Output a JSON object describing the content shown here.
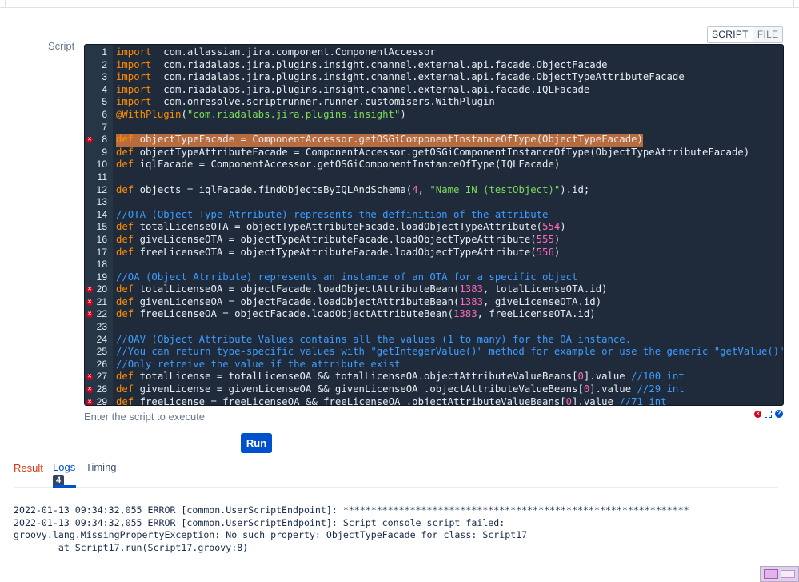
{
  "labels": {
    "script": "Script",
    "enter_hint": "Enter the script to execute",
    "run": "Run"
  },
  "mode_toggle": {
    "script": "SCRIPT",
    "file": "FILE"
  },
  "editor": {
    "error_marker": "✕",
    "lines": [
      {
        "n": "1",
        "err": false,
        "hl": false,
        "segs": [
          [
            "kw",
            "import"
          ],
          [
            "",
            "  com.atlassian.jira.component.ComponentAccessor"
          ]
        ]
      },
      {
        "n": "2",
        "err": false,
        "hl": false,
        "segs": [
          [
            "kw",
            "import"
          ],
          [
            "",
            "  com.riadalabs.jira.plugins.insight.channel.external.api.facade.ObjectFacade"
          ]
        ]
      },
      {
        "n": "3",
        "err": false,
        "hl": false,
        "segs": [
          [
            "kw",
            "import"
          ],
          [
            "",
            "  com.riadalabs.jira.plugins.insight.channel.external.api.facade.ObjectTypeAttributeFacade"
          ]
        ]
      },
      {
        "n": "4",
        "err": false,
        "hl": false,
        "segs": [
          [
            "kw",
            "import"
          ],
          [
            "",
            "  com.riadalabs.jira.plugins.insight.channel.external.api.facade.IQLFacade"
          ]
        ]
      },
      {
        "n": "5",
        "err": false,
        "hl": false,
        "segs": [
          [
            "kw",
            "import"
          ],
          [
            "",
            "  com.onresolve.scriptrunner.runner.customisers.WithPlugin"
          ]
        ]
      },
      {
        "n": "6",
        "err": false,
        "hl": false,
        "segs": [
          [
            "ann",
            "@WithPlugin"
          ],
          [
            "",
            "("
          ],
          [
            "str",
            "\"com.riadalabs.jira.plugins.insight\""
          ],
          [
            "",
            ")"
          ]
        ]
      },
      {
        "n": "7",
        "err": false,
        "hl": false,
        "segs": [
          [
            "",
            ""
          ]
        ]
      },
      {
        "n": "8",
        "err": true,
        "hl": true,
        "segs": [
          [
            "kw",
            "def"
          ],
          [
            "",
            " objectTypeFacade = ComponentAccessor.getOSGiComponentInstanceOfType(ObjectTypeFacade)"
          ]
        ]
      },
      {
        "n": "9",
        "err": false,
        "hl": false,
        "segs": [
          [
            "kw",
            "def"
          ],
          [
            "",
            " objectTypeAttributeFacade = ComponentAccessor.getOSGiComponentInstanceOfType(ObjectTypeAttributeFacade)"
          ]
        ]
      },
      {
        "n": "10",
        "err": false,
        "hl": false,
        "segs": [
          [
            "kw",
            "def"
          ],
          [
            "",
            " iqlFacade = ComponentAccessor.getOSGiComponentInstanceOfType(IQLFacade)"
          ]
        ]
      },
      {
        "n": "11",
        "err": false,
        "hl": false,
        "segs": [
          [
            "",
            ""
          ]
        ]
      },
      {
        "n": "12",
        "err": false,
        "hl": false,
        "segs": [
          [
            "kw",
            "def"
          ],
          [
            "",
            " objects = iqlFacade.findObjectsByIQLAndSchema("
          ],
          [
            "num-lit",
            "4"
          ],
          [
            "",
            ", "
          ],
          [
            "str",
            "\"Name IN (testObject)\""
          ],
          [
            "",
            ").id;"
          ]
        ]
      },
      {
        "n": "13",
        "err": false,
        "hl": false,
        "segs": [
          [
            "",
            ""
          ]
        ]
      },
      {
        "n": "14",
        "err": false,
        "hl": false,
        "segs": [
          [
            "cmt",
            "//OTA (Object Type Atrribute) represents the deffinition of the attribute"
          ]
        ]
      },
      {
        "n": "15",
        "err": false,
        "hl": false,
        "segs": [
          [
            "kw",
            "def"
          ],
          [
            "",
            " totalLicenseOTA = objectTypeAttributeFacade.loadObjectTypeAttribute("
          ],
          [
            "num-lit",
            "554"
          ],
          [
            "",
            ")"
          ]
        ]
      },
      {
        "n": "16",
        "err": false,
        "hl": false,
        "segs": [
          [
            "kw",
            "def"
          ],
          [
            "",
            " giveLicenseOTA = objectTypeAttributeFacade.loadObjectTypeAttribute("
          ],
          [
            "num-lit",
            "555"
          ],
          [
            "",
            ")"
          ]
        ]
      },
      {
        "n": "17",
        "err": false,
        "hl": false,
        "segs": [
          [
            "kw",
            "def"
          ],
          [
            "",
            " freeLicenseOTA = objectTypeAttributeFacade.loadObjectTypeAttribute("
          ],
          [
            "num-lit",
            "556"
          ],
          [
            "",
            ")"
          ]
        ]
      },
      {
        "n": "18",
        "err": false,
        "hl": false,
        "segs": [
          [
            "",
            ""
          ]
        ]
      },
      {
        "n": "19",
        "err": false,
        "hl": false,
        "segs": [
          [
            "cmt",
            "//OA (Object Atrribute) represents an instance of an OTA for a specific object"
          ]
        ]
      },
      {
        "n": "20",
        "err": true,
        "hl": false,
        "segs": [
          [
            "kw",
            "def"
          ],
          [
            "",
            " totalLicenseOA = objectFacade.loadObjectAttributeBean("
          ],
          [
            "num-lit",
            "1383"
          ],
          [
            "",
            ", totalLicenseOTA.id)"
          ]
        ]
      },
      {
        "n": "21",
        "err": true,
        "hl": false,
        "segs": [
          [
            "kw",
            "def"
          ],
          [
            "",
            " givenLicenseOA = objectFacade.loadObjectAttributeBean("
          ],
          [
            "num-lit",
            "1383"
          ],
          [
            "",
            ", giveLicenseOTA.id)"
          ]
        ]
      },
      {
        "n": "22",
        "err": true,
        "hl": false,
        "segs": [
          [
            "kw",
            "def"
          ],
          [
            "",
            " freeLicenseOA = objectFacade.loadObjectAttributeBean("
          ],
          [
            "num-lit",
            "1383"
          ],
          [
            "",
            ", freeLicenseOTA.id)"
          ]
        ]
      },
      {
        "n": "23",
        "err": false,
        "hl": false,
        "segs": [
          [
            "",
            ""
          ]
        ]
      },
      {
        "n": "24",
        "err": false,
        "hl": false,
        "segs": [
          [
            "cmt",
            "//OAV (Object Attribute Values contains all the values (1 to many) for the OA instance."
          ]
        ]
      },
      {
        "n": "25",
        "err": false,
        "hl": false,
        "segs": [
          [
            "cmt",
            "//You can return type-specific values with \"getIntegerValue()\" method for example or use the generic \"getValue()\" metho"
          ]
        ]
      },
      {
        "n": "26",
        "err": false,
        "hl": false,
        "segs": [
          [
            "cmt",
            "//Only retreive the value if the attribute exist"
          ]
        ]
      },
      {
        "n": "27",
        "err": true,
        "hl": false,
        "segs": [
          [
            "kw",
            "def"
          ],
          [
            "",
            " totalLicense = totalLicenseOA && totalLicenseOA.objectAttributeValueBeans["
          ],
          [
            "num-lit",
            "0"
          ],
          [
            "",
            "].value "
          ],
          [
            "cmt",
            "//100 int"
          ]
        ]
      },
      {
        "n": "28",
        "err": true,
        "hl": false,
        "segs": [
          [
            "kw",
            "def"
          ],
          [
            "",
            " givenLicense = givenLicenseOA && givenLicenseOA .objectAttributeValueBeans["
          ],
          [
            "num-lit",
            "0"
          ],
          [
            "",
            "].value "
          ],
          [
            "cmt",
            "//29 int"
          ]
        ]
      },
      {
        "n": "29",
        "err": true,
        "hl": false,
        "segs": [
          [
            "kw",
            "def"
          ],
          [
            "",
            " freeLicense = freeLicenseOA && freeLicenseOA .objectAttributeValueBeans["
          ],
          [
            "num-lit",
            "0"
          ],
          [
            "",
            "].value "
          ],
          [
            "cmt",
            "//71 int"
          ]
        ]
      }
    ]
  },
  "tabs": {
    "result": "Result",
    "logs": "Logs",
    "logs_count": "4",
    "timing": "Timing",
    "active": "logs"
  },
  "log_lines": [
    "2022-01-13 09:34:32,055 ERROR [common.UserScriptEndpoint]: **************************************************************",
    "2022-01-13 09:34:32,055 ERROR [common.UserScriptEndpoint]: Script console script failed:",
    "groovy.lang.MissingPropertyException: No such property: ObjectTypeFacade for class: Script17",
    "        at Script17.run(Script17.groovy:8)"
  ],
  "colors": {
    "editor_bg": "#1f2b3a",
    "keyword": "#ff8c00",
    "string": "#7ddb5a",
    "number": "#ff69c0",
    "comment": "#3d9cff",
    "highlight": "#b86b3c",
    "run_button": "#0052cc",
    "result_tab": "#de350b"
  }
}
